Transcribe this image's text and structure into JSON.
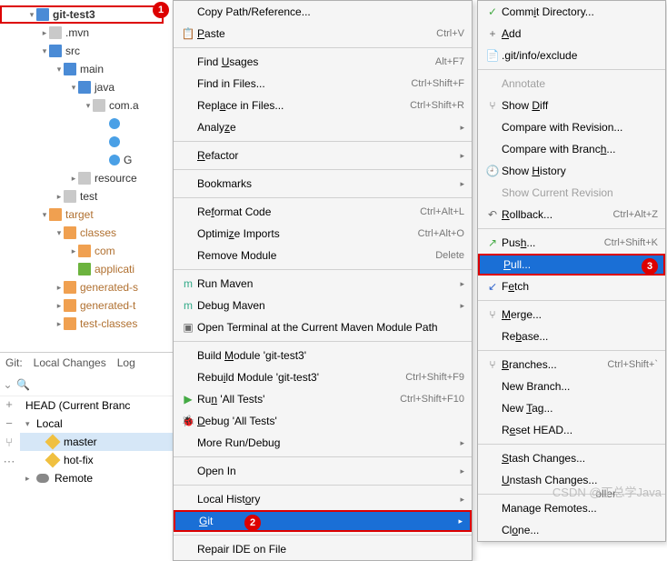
{
  "tree": {
    "root": "git-test3",
    "items": [
      ".mvn",
      "src",
      "main",
      "java",
      "com.a",
      "G",
      "resource",
      "test",
      "target",
      "classes",
      "com",
      "applicati",
      "generated-s",
      "generated-t",
      "test-classes"
    ]
  },
  "badges": {
    "b1": "1",
    "b2": "2",
    "b3": "3"
  },
  "gitpanel": {
    "title": "Git:",
    "local_changes": "Local Changes",
    "log": "Log",
    "search_placeholder": "",
    "head": "HEAD (Current Branc",
    "local": "Local",
    "master": "master",
    "hotfix": "hot-fix",
    "remote": "Remote"
  },
  "menu1": {
    "copy_path": "Copy Path/Reference...",
    "paste": "Paste",
    "paste_sc": "Ctrl+V",
    "find_usages": "Find Usages",
    "find_usages_sc": "Alt+F7",
    "find_in_files": "Find in Files...",
    "find_in_files_sc": "Ctrl+Shift+F",
    "replace_in_files": "Replace in Files...",
    "replace_in_files_sc": "Ctrl+Shift+R",
    "analyze": "Analyze",
    "refactor": "Refactor",
    "bookmarks": "Bookmarks",
    "reformat_code": "Reformat Code",
    "reformat_code_sc": "Ctrl+Alt+L",
    "optimize_imports": "Optimize Imports",
    "optimize_imports_sc": "Ctrl+Alt+O",
    "remove_module": "Remove Module",
    "remove_module_sc": "Delete",
    "run_maven": "Run Maven",
    "debug_maven": "Debug Maven",
    "open_terminal": "Open Terminal at the Current Maven Module Path",
    "build_module": "Build Module 'git-test3'",
    "rebuild_module": "Rebuild Module 'git-test3'",
    "rebuild_module_sc": "Ctrl+Shift+F9",
    "run_tests": "Run 'All Tests'",
    "run_tests_sc": "Ctrl+Shift+F10",
    "debug_tests": "Debug 'All Tests'",
    "more_run": "More Run/Debug",
    "open_in": "Open In",
    "local_history": "Local History",
    "git": "Git",
    "repair_ide": "Repair IDE on File"
  },
  "menu2": {
    "commit_dir": "Commit Directory...",
    "add": "Add",
    "git_info_exclude": ".git/info/exclude",
    "annotate": "Annotate",
    "show_diff": "Show Diff",
    "compare_revision": "Compare with Revision...",
    "compare_branch": "Compare with Branch...",
    "show_history": "Show History",
    "show_current_revision": "Show Current Revision",
    "rollback": "Rollback...",
    "rollback_sc": "Ctrl+Alt+Z",
    "push": "Push...",
    "push_sc": "Ctrl+Shift+K",
    "pull": "Pull...",
    "fetch": "Fetch",
    "merge": "Merge...",
    "rebase": "Rebase...",
    "branches": "Branches...",
    "branches_sc": "Ctrl+Shift+`",
    "new_branch": "New Branch...",
    "new_tag": "New Tag...",
    "reset_head": "Reset HEAD...",
    "stash": "Stash Changes...",
    "unstash": "Unstash Changes...",
    "manage_remotes": "Manage Remotes...",
    "clone": "Clone..."
  },
  "footer": {
    "watermark": "CSDN @丁总学Java",
    "scroller": "oller"
  }
}
